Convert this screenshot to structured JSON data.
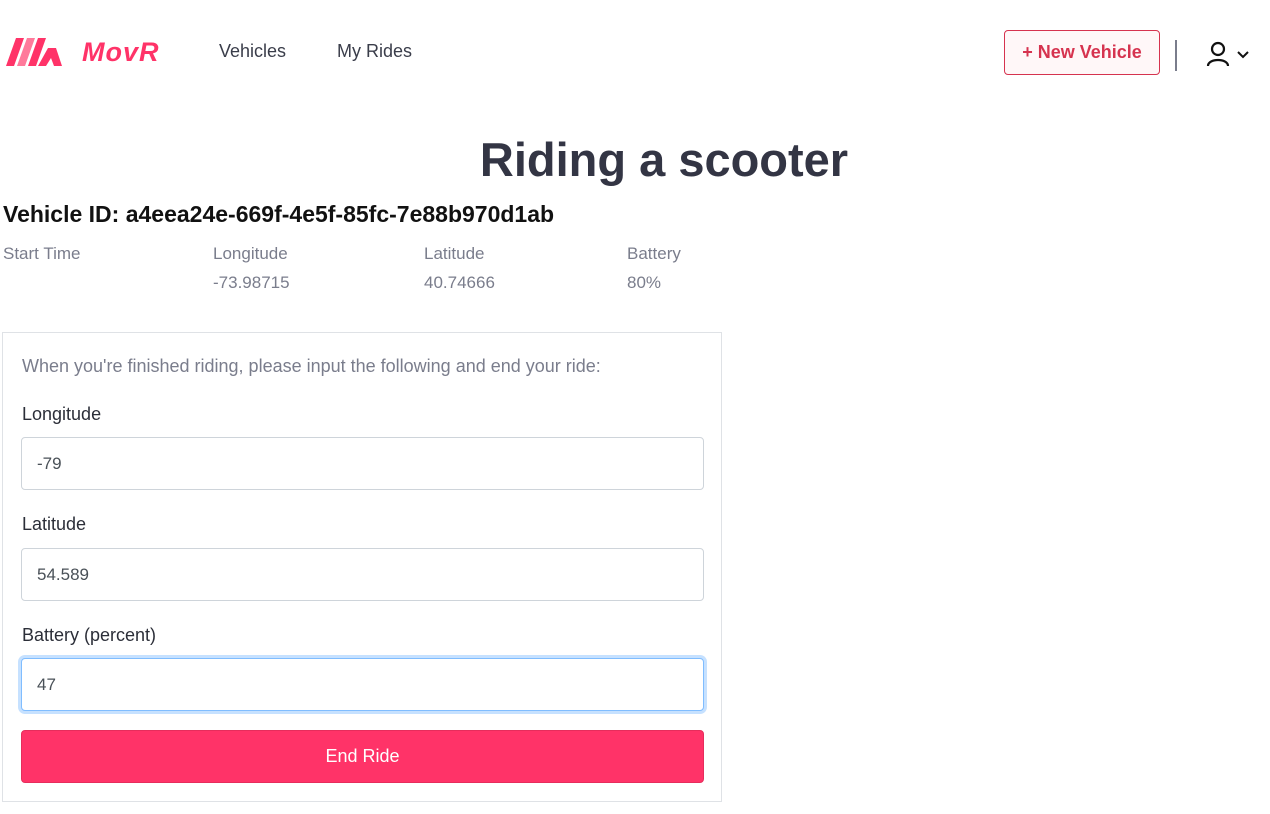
{
  "app": {
    "brand_name": "MovR",
    "brand_color": "#ff3368",
    "accent_color": "#d6334f"
  },
  "nav": {
    "links": [
      {
        "label": "Vehicles"
      },
      {
        "label": "My Rides"
      }
    ],
    "new_vehicle_label": "+ New Vehicle",
    "user_icon": "user-icon",
    "dropdown_icon": "chevron-down-icon"
  },
  "page": {
    "title": "Riding a scooter",
    "vehicle_id": "Vehicle ID: a4eea24e-669f-4e5f-85fc-7e88b970d1ab"
  },
  "ride_stats": [
    {
      "label": "Start Time",
      "value": ""
    },
    {
      "label": "Longitude",
      "value": "-73.98715"
    },
    {
      "label": "Latitude",
      "value": "40.74666"
    },
    {
      "label": "Battery",
      "value": "80%"
    }
  ],
  "end_ride_form": {
    "instructions": "When you're finished riding, please input the following and end your ride:",
    "fields": [
      {
        "label": "Longitude",
        "value": "-79"
      },
      {
        "label": "Latitude",
        "value": "54.589"
      },
      {
        "label": "Battery (percent)",
        "value": "47"
      }
    ],
    "submit_label": "End Ride"
  }
}
